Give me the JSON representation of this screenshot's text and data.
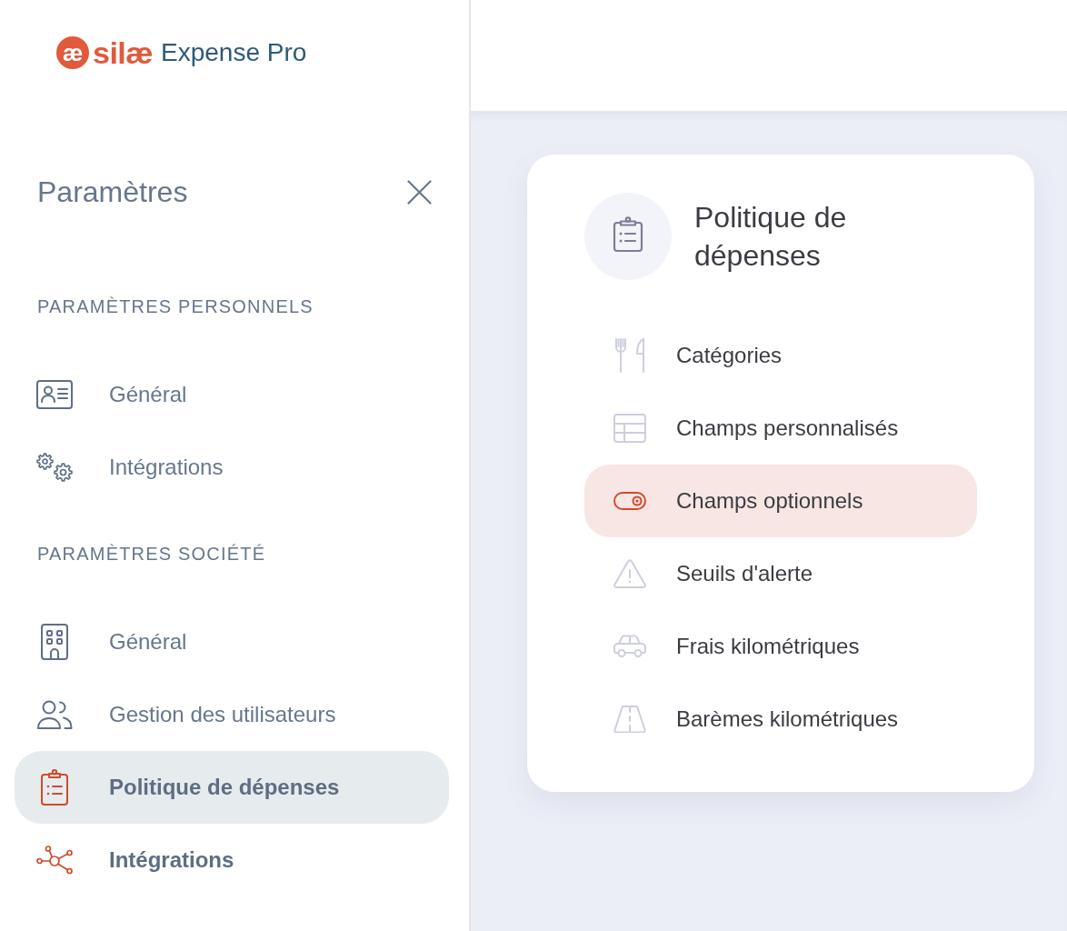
{
  "logo": {
    "mark": "æ",
    "brand": "silæ",
    "product": "Expense Pro"
  },
  "sidebar": {
    "title": "Paramètres",
    "sections": [
      {
        "heading": "PARAMÈTRES PERSONNELS",
        "items": [
          {
            "label": "Général",
            "selected": false,
            "active": false
          },
          {
            "label": "Intégrations",
            "selected": false,
            "active": false
          }
        ]
      },
      {
        "heading": "PARAMÈTRES SOCIÉTÉ",
        "items": [
          {
            "label": "Général",
            "selected": false,
            "active": false
          },
          {
            "label": "Gestion des utilisateurs",
            "selected": false,
            "active": false
          },
          {
            "label": "Politique de dépenses",
            "selected": true,
            "active": true
          },
          {
            "label": "Intégrations",
            "selected": false,
            "active": true
          }
        ]
      }
    ]
  },
  "card": {
    "title": "Politique de dépenses",
    "items": [
      {
        "label": "Catégories",
        "selected": false
      },
      {
        "label": "Champs personnalisés",
        "selected": false
      },
      {
        "label": "Champs optionnels",
        "selected": true
      },
      {
        "label": "Seuils d'alerte",
        "selected": false
      },
      {
        "label": "Frais kilométriques",
        "selected": false
      },
      {
        "label": "Barèmes kilométriques",
        "selected": false
      }
    ]
  }
}
